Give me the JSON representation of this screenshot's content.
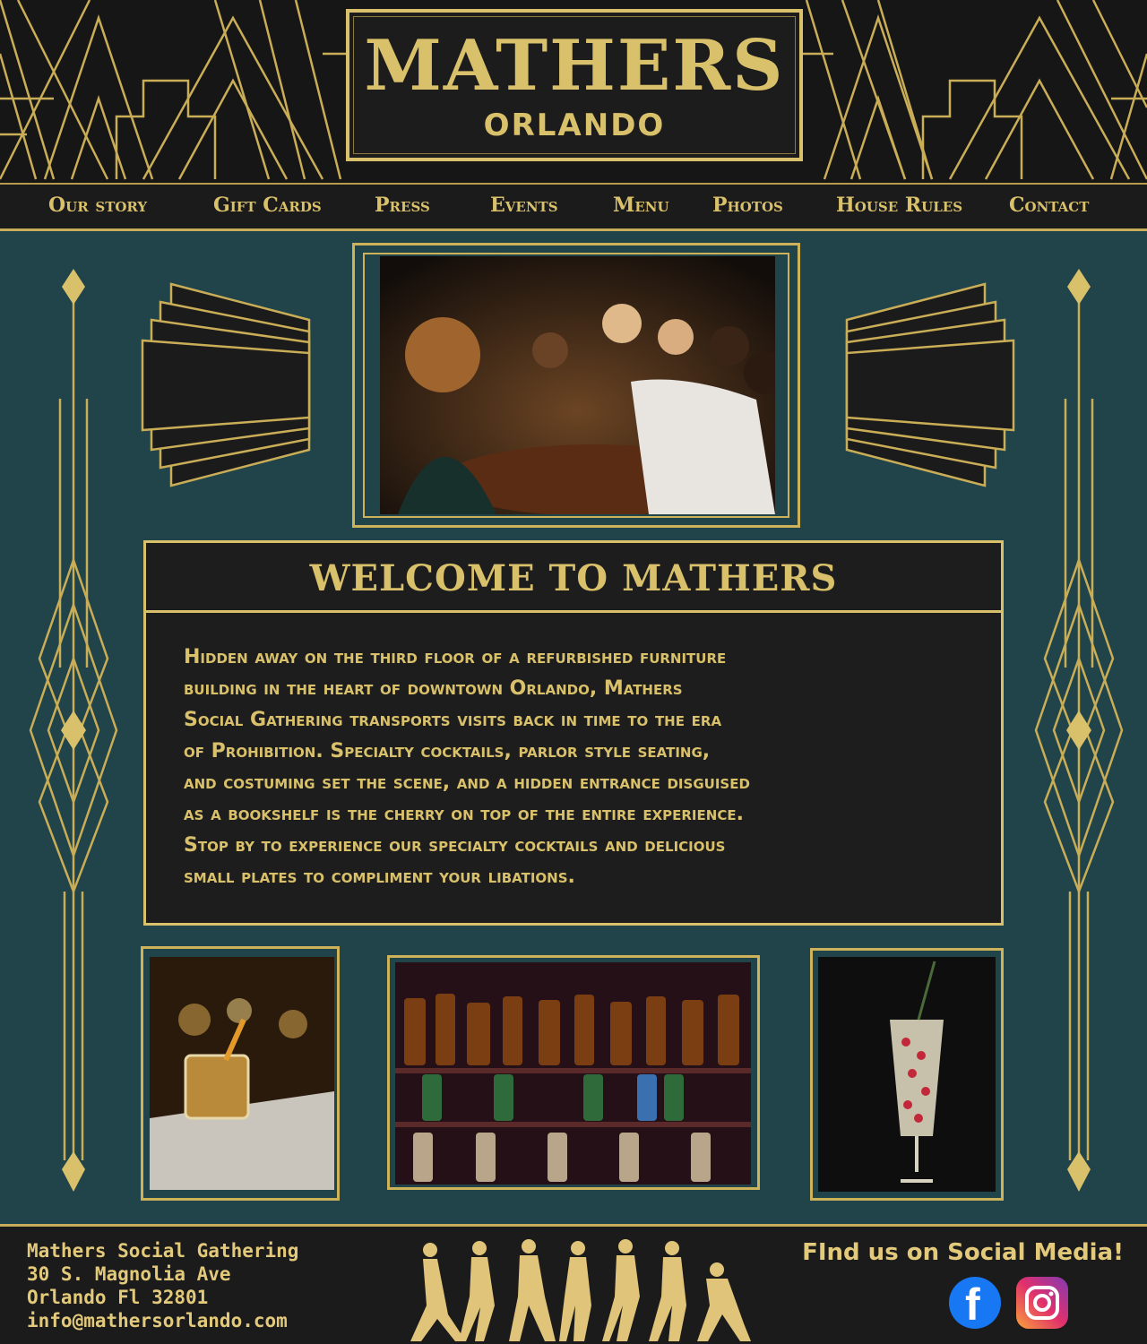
{
  "brand": {
    "name": "MATHERS",
    "city": "ORLANDO"
  },
  "nav": {
    "items": [
      "Our story",
      "Gift Cards",
      "Press",
      "Events",
      "Menu",
      "Photos",
      "House Rules",
      "Contact"
    ]
  },
  "welcome": {
    "title": "WELCOME TO MATHERS",
    "body": "Hidden away on the third floor of a refurbished furniture\nbuilding in the heart of downtown Orlando, Mathers\nSocial Gathering transports visits back in time to the era\nof Prohibition. Specialty cocktails, parlor style seating,\nand costuming  set the scene, and a hidden entrance disguised\nas a bookshelf is the cherry on top of the entire experience.\nStop  by to experience our specialty cocktails and delicious\nsmall plates to compliment your libations."
  },
  "footer": {
    "address": {
      "name": "Mathers Social Gathering",
      "street": "30 S. Magnolia Ave",
      "city": "Orlando Fl 32801",
      "email": "info@mathersorlando.com"
    },
    "social_heading": "FInd us on Social Media!",
    "social": {
      "facebook_glyph": "f"
    }
  },
  "colors": {
    "gold": "#d9c06a",
    "teal": "#21434a",
    "dark": "#1b1b1b"
  }
}
